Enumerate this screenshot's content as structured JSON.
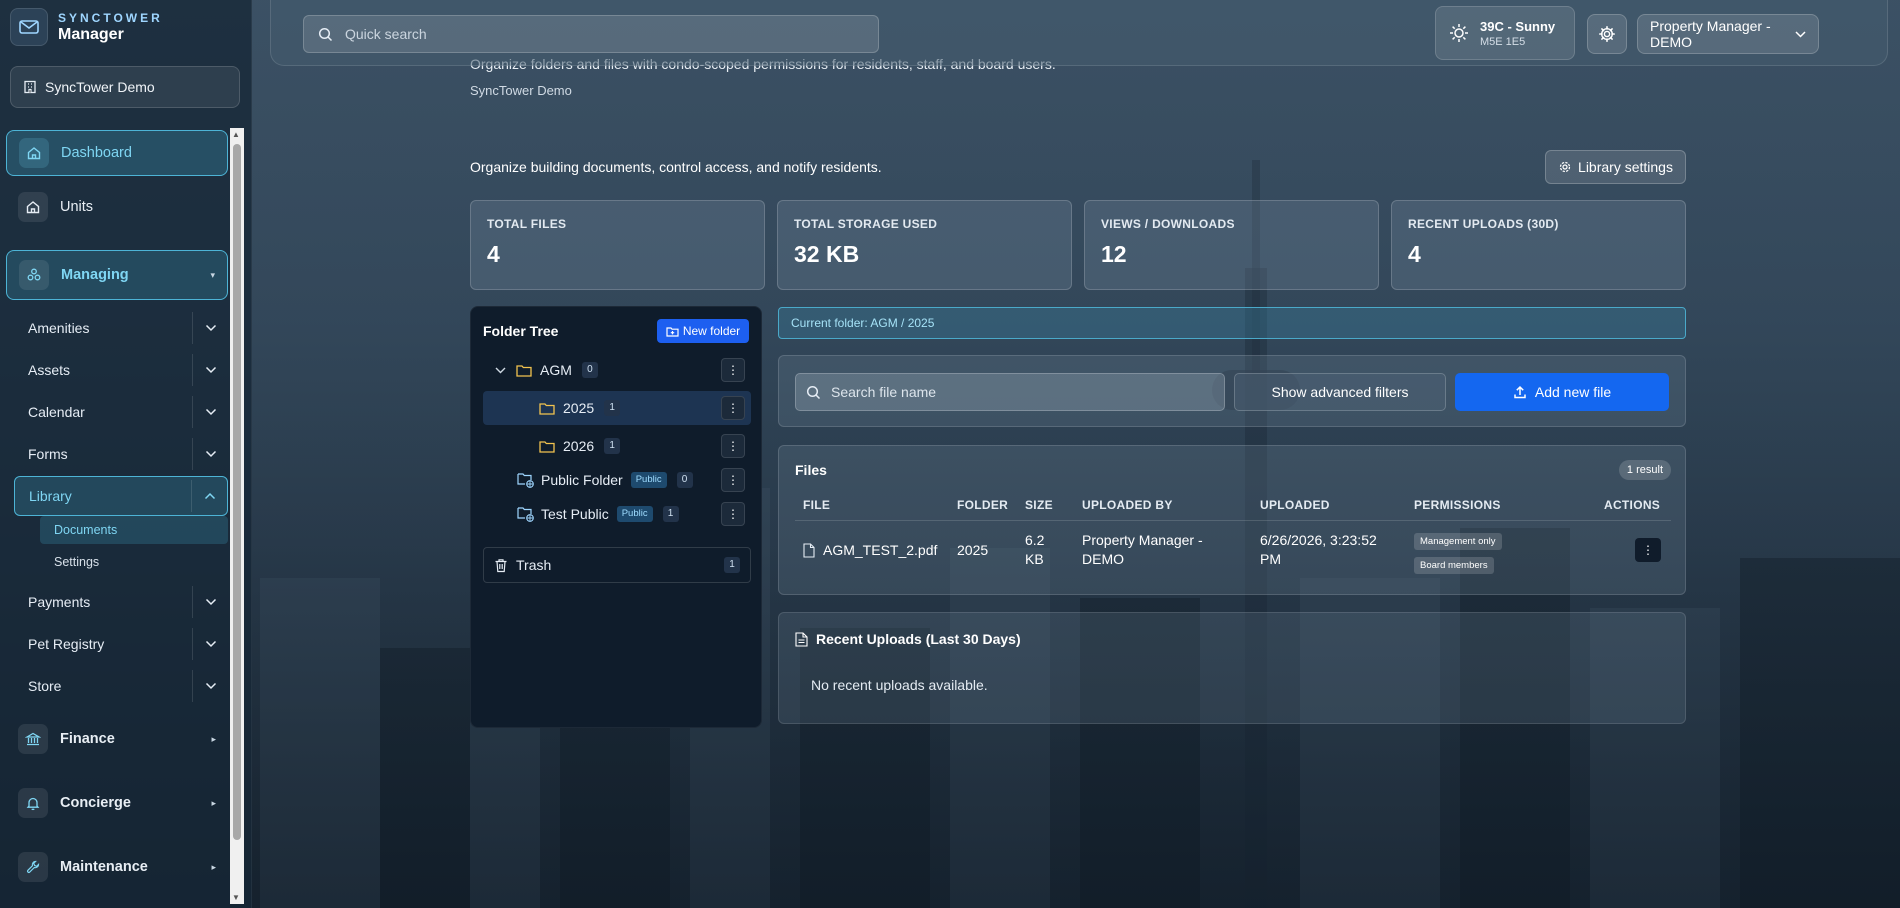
{
  "brand": {
    "top": "SYNCTOWER",
    "bottom": "Manager"
  },
  "org": {
    "name": "SyncTower Demo"
  },
  "nav": {
    "dashboard": "Dashboard",
    "units": "Units",
    "managing": "Managing",
    "amenities": "Amenities",
    "assets": "Assets",
    "calendar": "Calendar",
    "forms": "Forms",
    "library": "Library",
    "documents": "Documents",
    "settings": "Settings",
    "payments": "Payments",
    "pet_registry": "Pet Registry",
    "store": "Store",
    "finance": "Finance",
    "concierge": "Concierge",
    "maintenance": "Maintenance"
  },
  "topbar": {
    "search_placeholder": "Quick search",
    "weather_temp": "39C - Sunny",
    "weather_postal": "M5E 1E5",
    "user": "Property Manager - DEMO"
  },
  "header": {
    "peek_text": "Organize folders and files with condo-scoped permissions for residents, staff, and board users.",
    "peek_sub": "SyncTower Demo"
  },
  "main": {
    "intro": "Organize building documents, control access, and notify residents.",
    "library_settings": "Library settings"
  },
  "stats": [
    {
      "label": "TOTAL FILES",
      "value": "4"
    },
    {
      "label": "TOTAL STORAGE USED",
      "value": "32 KB"
    },
    {
      "label": "VIEWS / DOWNLOADS",
      "value": "12"
    },
    {
      "label": "RECENT UPLOADS (30D)",
      "value": "4"
    }
  ],
  "tree": {
    "title": "Folder Tree",
    "new_folder": "New folder",
    "items": [
      {
        "name": "AGM",
        "count": "0"
      },
      {
        "name": "2025",
        "count": "1"
      },
      {
        "name": "2026",
        "count": "1"
      },
      {
        "name": "Public Folder",
        "tag": "Public",
        "count": "0"
      },
      {
        "name": "Test Public",
        "tag": "Public",
        "count": "1"
      }
    ],
    "trash": {
      "name": "Trash",
      "count": "1"
    }
  },
  "current_folder": "Current folder: AGM / 2025",
  "filters": {
    "search_placeholder": "Search file name",
    "advanced": "Show advanced filters",
    "add_file": "Add new file"
  },
  "files": {
    "title": "Files",
    "result_count": "1 result",
    "columns": [
      "FILE",
      "FOLDER",
      "SIZE",
      "UPLOADED BY",
      "UPLOADED",
      "PERMISSIONS",
      "ACTIONS"
    ],
    "rows": [
      {
        "file": "AGM_TEST_2.pdf",
        "folder": "2025",
        "size": "6.2 KB",
        "uploaded_by": "Property Manager - DEMO",
        "uploaded": "6/26/2026, 3:23:52 PM",
        "permissions": [
          "Management only",
          "Board members"
        ]
      }
    ]
  },
  "recent": {
    "title": "Recent Uploads (Last 30 Days)",
    "empty": "No recent uploads available."
  },
  "colors": {
    "accent": "#4db4d6",
    "primary_button": "#1467f0",
    "tree_bg": "#0f1c2b"
  }
}
